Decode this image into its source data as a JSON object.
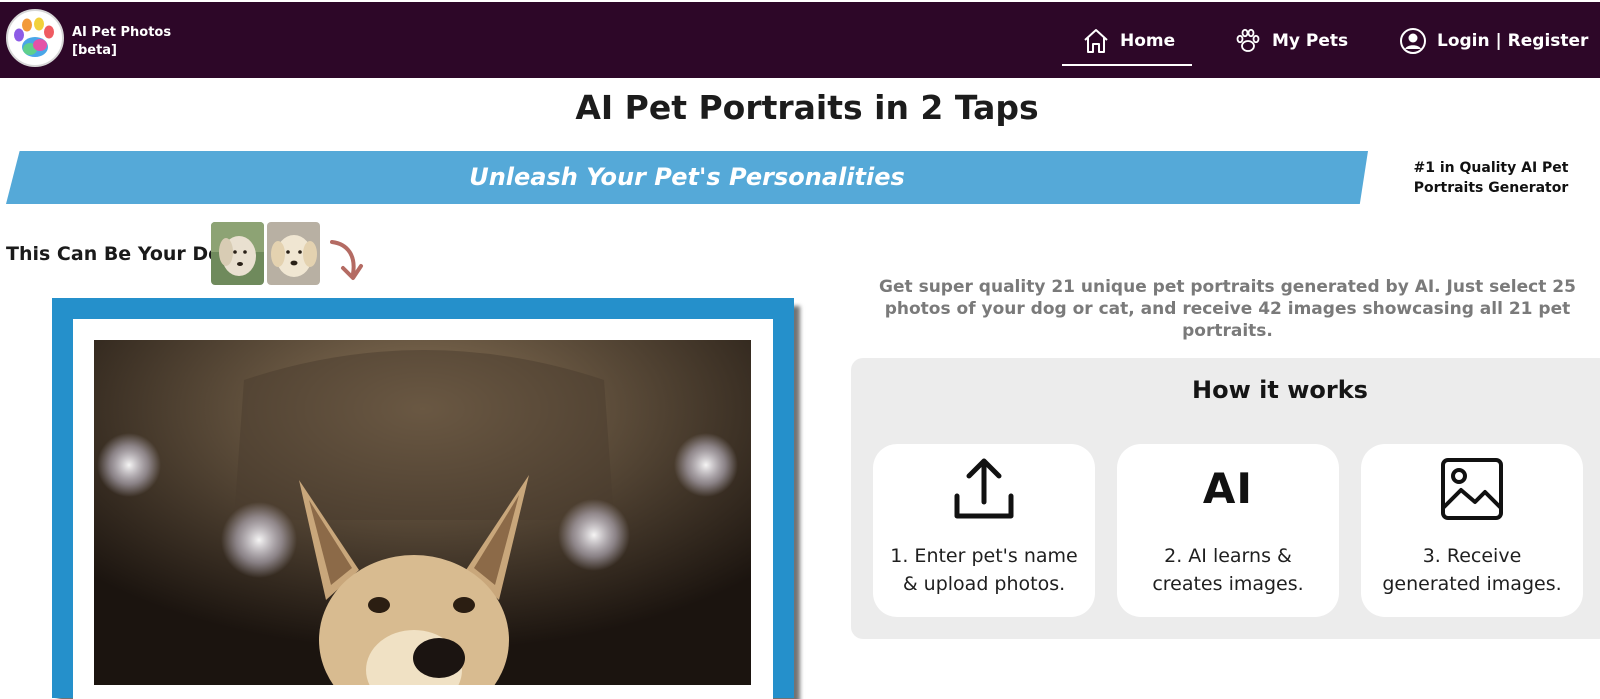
{
  "nav": {
    "brand_name": "AI Pet Photos",
    "brand_tag": "[beta]",
    "home_label": "Home",
    "pets_label": "My Pets",
    "login_label": "Login | Register",
    "bg_color": "#2d0728"
  },
  "hero": {
    "title": "AI Pet Portraits in 2 Taps",
    "banner_text": "Unleash Your Pet's Personalities",
    "banner_color": "#55a9d8",
    "quality_badge": "#1 in Quality AI Pet Portraits Generator"
  },
  "dog": {
    "label": "This Can Be Your Dog",
    "frame_color": "#2590cb"
  },
  "intro": {
    "description": "Get super quality 21 unique pet portraits generated by AI. Just select 25 photos of your dog or cat, and receive 42 images showcasing all 21 pet portraits."
  },
  "how_it_works": {
    "title": "How it works",
    "steps": [
      {
        "icon": "upload-icon",
        "text": "1. Enter pet's name & upload photos."
      },
      {
        "icon": "ai-icon",
        "text": "2. AI learns & creates images.",
        "glyph": "AI"
      },
      {
        "icon": "image-icon",
        "text": "3. Receive generated images."
      }
    ]
  }
}
